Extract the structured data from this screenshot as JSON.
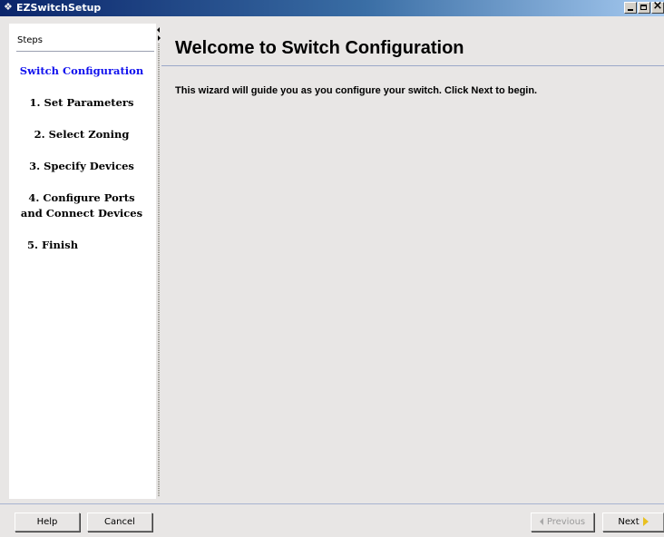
{
  "window": {
    "title": "EZSwitchSetup"
  },
  "steps_panel": {
    "header": "Steps",
    "items": [
      {
        "label": "Switch Configuration",
        "active": true
      },
      {
        "label": "1. Set Parameters"
      },
      {
        "label": "2. Select Zoning"
      },
      {
        "label": "3. Specify Devices"
      },
      {
        "label_line1": "4. Configure Ports",
        "label_line2": "and Connect Devices"
      },
      {
        "label": "5. Finish"
      }
    ]
  },
  "content": {
    "title": "Welcome to Switch Configuration",
    "intro": "This wizard will guide you as you configure your switch. Click Next to begin."
  },
  "buttons": {
    "help": "Help",
    "cancel": "Cancel",
    "previous": "Previous",
    "next": "Next"
  },
  "colors": {
    "active_step": "#1010ee",
    "title_bar": "#0a246a",
    "next_arrow": "#e8c020"
  },
  "icons": {
    "app": "switch-app-icon",
    "next": "arrow-right-icon",
    "previous": "arrow-left-icon"
  }
}
